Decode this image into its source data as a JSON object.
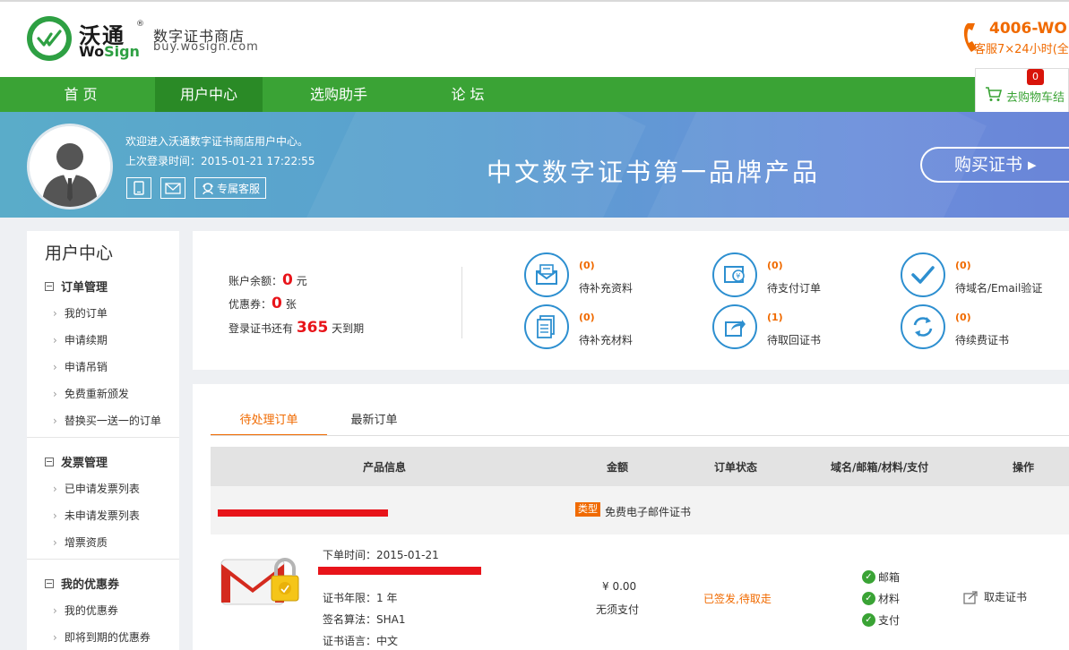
{
  "header": {
    "brand_cn": "沃通",
    "brand_en_prefix": "Wo",
    "brand_en_suffix": "Sign",
    "reg_mark": "®",
    "store_name": "数字证书商店",
    "store_url": "buy.wosign.com",
    "hotline_number": "4006-WO",
    "hotline_sub": "客服7×24小时(全"
  },
  "nav": {
    "items": [
      {
        "label": "首 页"
      },
      {
        "label": "用户中心"
      },
      {
        "label": "选购助手"
      },
      {
        "label": "论 坛"
      }
    ],
    "cart_count": "0",
    "cart_label": "去购物车结"
  },
  "banner": {
    "welcome": "欢迎进入沃通数字证书商店用户中心。",
    "last_login": "上次登录时间：2015-01-21 17:22:55",
    "service_label": "专属客服",
    "slogan": "中文数字证书第一品牌产品",
    "buy_label": "购买证书 ▸"
  },
  "sidebar": {
    "title": "用户中心",
    "sections": [
      {
        "title": "订单管理",
        "items": [
          "我的订单",
          "申请续期",
          "申请吊销",
          "免费重新颁发",
          "替换买一送一的订单"
        ]
      },
      {
        "title": "发票管理",
        "items": [
          "已申请发票列表",
          "未申请发票列表",
          "增票资质"
        ]
      },
      {
        "title": "我的优惠券",
        "items": [
          "我的优惠券",
          "即将到期的优惠券"
        ]
      }
    ]
  },
  "account": {
    "balance_label": "账户余额：",
    "balance_value": "0",
    "balance_unit": "元",
    "coupon_label": "优惠券：",
    "coupon_value": "0",
    "coupon_unit": "张",
    "expire_label": "登录证书还有",
    "expire_value": "365",
    "expire_unit": "天到期"
  },
  "stats": [
    {
      "count": "(0)",
      "label": "待补充资料"
    },
    {
      "count": "(0)",
      "label": "待支付订单"
    },
    {
      "count": "(0)",
      "label": "待域名/Email验证"
    },
    {
      "count": "(0)",
      "label": "待补充材料"
    },
    {
      "count": "(1)",
      "label": "待取回证书"
    },
    {
      "count": "(0)",
      "label": "待续费证书"
    }
  ],
  "orders": {
    "tabs": [
      "待处理订单",
      "最新订单"
    ],
    "columns": [
      "产品信息",
      "金额",
      "订单状态",
      "域名/邮箱/材料/支付",
      "操作"
    ],
    "order": {
      "type_badge": "类型",
      "product_name": "免费电子邮件证书",
      "order_time": "下单时间：2015-01-21",
      "cert_years": "证书年限：1 年",
      "algorithm": "签名算法：SHA1",
      "cert_lang": "证书语言：中文",
      "amount": "¥ 0.00",
      "payment_note": "无须支付",
      "status": "已签发,待取走",
      "checks": [
        "邮箱",
        "材料",
        "支付"
      ],
      "action": "取走证书"
    }
  },
  "colors": {
    "brand_green": "#3aa335",
    "accent_orange": "#f06a00",
    "alert_red": "#e8141a",
    "icon_blue": "#2d8fd0"
  }
}
